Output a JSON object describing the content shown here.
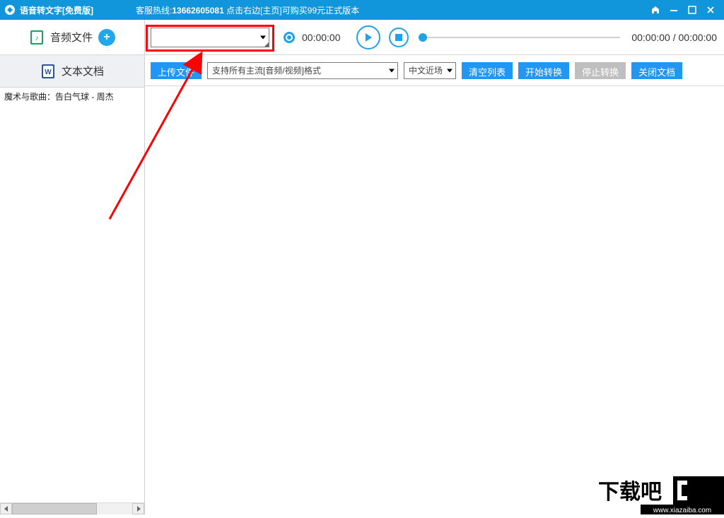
{
  "titlebar": {
    "app_title": "语音转文字[免费版]",
    "hotline_prefix": "客服热线:",
    "hotline_number": "13662605081",
    "hotline_suffix": "  点击右边[主页]可购买99元正式版本"
  },
  "top": {
    "audio_files_label": "音频文件",
    "add_label": "+",
    "record_time": "00:00:00",
    "play_time": "00:00:00 / 00:00:00"
  },
  "sidebar": {
    "doc_tab_label": "文本文档",
    "files": [
      "魔术与歌曲：告白气球 - 周杰"
    ]
  },
  "toolbar": {
    "upload_label": "上传文件",
    "format_placeholder": "支持所有主流[音频/视频]格式",
    "lang_label": "中文近场",
    "clear_label": "清空列表",
    "start_label": "开始转换",
    "stop_label": "停止转换",
    "close_doc_label": "关闭文档"
  },
  "watermark": {
    "text_main": "下载吧",
    "text_url": "www.xiazaiba.com"
  }
}
